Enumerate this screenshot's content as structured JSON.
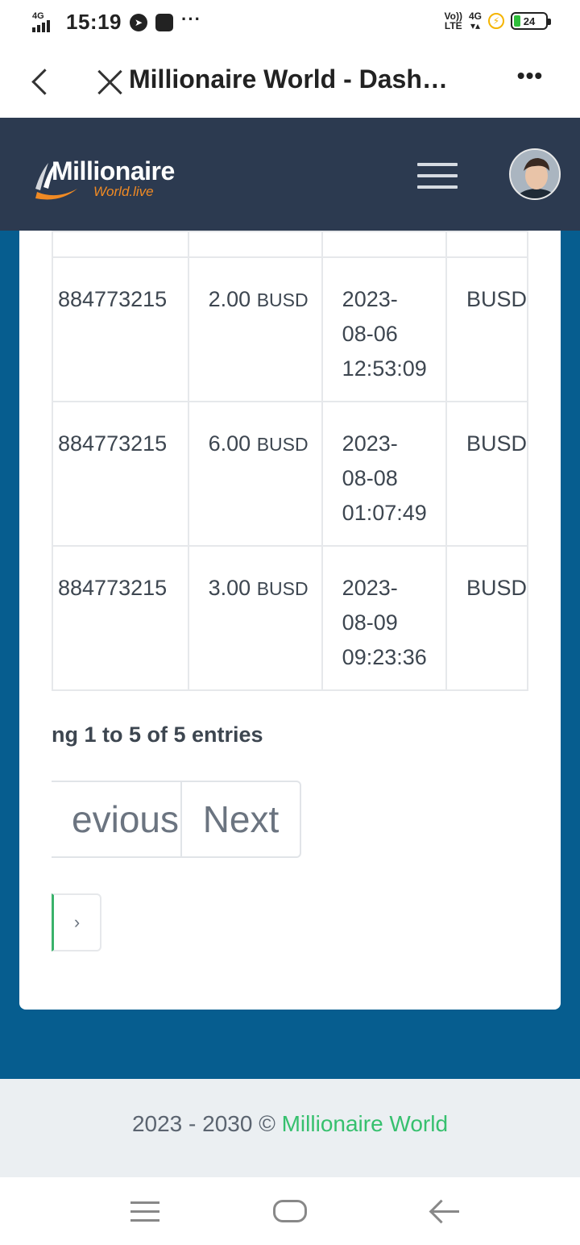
{
  "status_bar": {
    "network_tag": "4G",
    "time": "15:19",
    "volte": "Vo))",
    "lte": "LTE",
    "net_right": "4G",
    "battery": "24"
  },
  "browser": {
    "page_title": "Millionaire World - Dash…"
  },
  "header": {
    "logo_main": "Millionaire",
    "logo_sub": "World.live"
  },
  "table": {
    "rows": [
      {
        "id": "884773215",
        "amount": "2.00",
        "currency": "BUSD",
        "date": "2023-",
        "date2": "08-06",
        "time": "12:53:09",
        "type": "BUSD"
      },
      {
        "id": "884773215",
        "amount": "6.00",
        "currency": "BUSD",
        "date": "2023-",
        "date2": "08-08",
        "time": "01:07:49",
        "type": "BUSD"
      },
      {
        "id": "884773215",
        "amount": "3.00",
        "currency": "BUSD",
        "date": "2023-",
        "date2": "08-09",
        "time": "09:23:36",
        "type": "BUSD"
      }
    ]
  },
  "entries_info": "ng 1 to 5 of 5 entries",
  "pagination": {
    "previous": "evious",
    "next": "Next",
    "small_next": "›"
  },
  "footer": {
    "years": "2023 - 2030 © ",
    "brand": "Millionaire World"
  },
  "colors": {
    "header_bg": "#2c3a50",
    "main_bg": "#065d8f",
    "accent_green": "#36c06e",
    "logo_orange": "#f08a24"
  }
}
